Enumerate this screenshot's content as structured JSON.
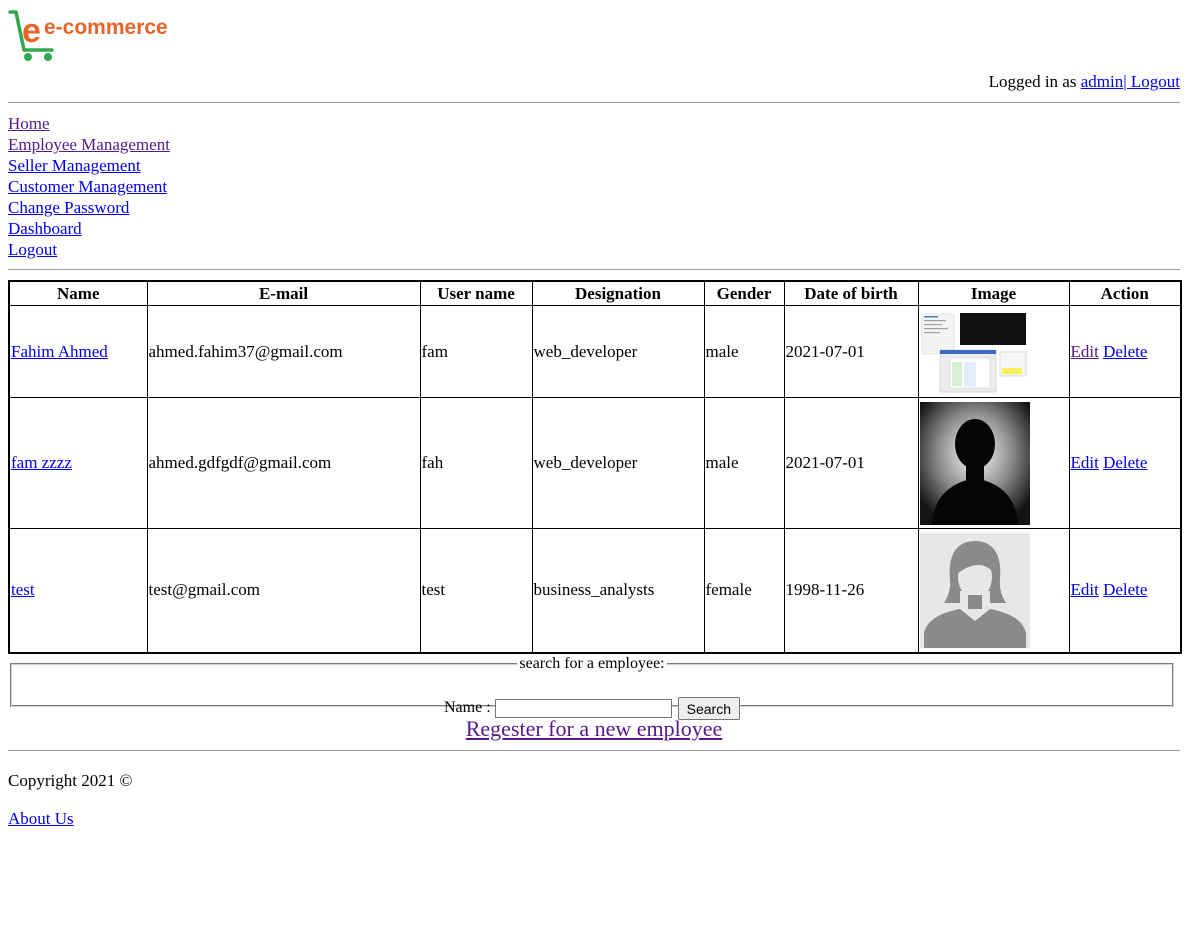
{
  "header": {
    "logo_text": "e-commerce",
    "logged_in_prefix": "Logged in as ",
    "username": "admin",
    "logout_label": "| Logout"
  },
  "nav": {
    "items": [
      {
        "label": "Home"
      },
      {
        "label": "Employee Management"
      },
      {
        "label": "Seller Management"
      },
      {
        "label": "Customer Management"
      },
      {
        "label": "Change Password"
      },
      {
        "label": "Dashboard"
      },
      {
        "label": "Logout"
      }
    ]
  },
  "table": {
    "headers": [
      "Name",
      "E-mail",
      "User name",
      "Designation",
      "Gender",
      "Date of birth",
      "Image",
      "Action"
    ],
    "rows": [
      {
        "name": "Fahim Ahmed",
        "email": "ahmed.fahim37@gmail.com",
        "username": "fam",
        "designation": "web_developer",
        "gender": "male",
        "dob": "2021-07-01",
        "image": "screenshot-thumbnail",
        "edit_label": "Edit",
        "delete_label": "Delete"
      },
      {
        "name": "fam zzzz",
        "email": "ahmed.gdfgdf@gmail.com",
        "username": "fah",
        "designation": "web_developer",
        "gender": "male",
        "dob": "2021-07-01",
        "image": "male-silhouette",
        "edit_label": "Edit",
        "delete_label": "Delete"
      },
      {
        "name": "test",
        "email": "test@gmail.com",
        "username": "test",
        "designation": "business_analysts",
        "gender": "female",
        "dob": "1998-11-26",
        "image": "female-avatar",
        "edit_label": "Edit",
        "delete_label": "Delete"
      }
    ]
  },
  "search": {
    "legend": "search for a employee:",
    "name_label": "Name :",
    "value": "",
    "button_label": "Search"
  },
  "register_label": "Regester for a new employee",
  "footer": {
    "copyright": "Copyright 2021 ©",
    "about_label": "About Us"
  },
  "colors": {
    "logo_orange": "#e8642a",
    "logo_green": "#2fa84f",
    "link": "#0000ee",
    "visited_link": "#551a8b"
  }
}
